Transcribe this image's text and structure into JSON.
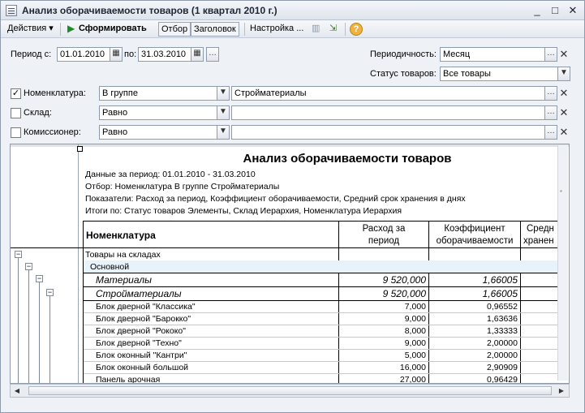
{
  "window": {
    "title": "Анализ оборачиваемости товаров (1 квартал 2010 г.)",
    "controls": [
      "_",
      "□",
      "✕"
    ]
  },
  "toolbar": {
    "actions": "Действия ▾",
    "generate": "Сформировать",
    "filter": "Отбор",
    "header": "Заголовок",
    "settings": "Настройка ..."
  },
  "params": {
    "period_from_label": "Период с:",
    "period_from": "01.01.2010",
    "period_to_label": "по:",
    "period_to": "31.03.2010",
    "periodicity_label": "Периодичность:",
    "periodicity": "Месяц",
    "goods_status_label": "Статус товаров:",
    "goods_status": "Все товары",
    "nomenclature_label": "Номенклатура:",
    "nomenclature_checked": true,
    "nomenclature_cond": "В группе",
    "nomenclature_value": "Стройматериалы",
    "warehouse_label": "Склад:",
    "warehouse_checked": false,
    "warehouse_cond": "Равно",
    "warehouse_value": "",
    "consignor_label": "Комиссионер:",
    "consignor_checked": false,
    "consignor_cond": "Равно",
    "consignor_value": ""
  },
  "report": {
    "title": "Анализ оборачиваемости товаров",
    "line1": "Данные за период: 01.01.2010 - 31.03.2010",
    "line2": "Отбор: Номенклатура В группе Стройматериалы",
    "line3": "Показатели:  Расход за период, Коэффициент оборачиваемости, Средний срок хранения в днях",
    "line4": "Итоги по:  Статус товаров Элементы, Склад Иерархия, Номенклатура Иерархия",
    "col_name": "Номенклатура",
    "col_exp_1": "Расход за",
    "col_exp_2": "период",
    "col_coef_1": "Коэффициент",
    "col_coef_2": "оборачиваемости",
    "col_avg_1": "Средн",
    "col_avg_2": "хранен",
    "rows": [
      {
        "name": "Товары на складах",
        "exp": "",
        "coef": ""
      },
      {
        "name": "Основной",
        "exp": "",
        "coef": ""
      },
      {
        "name": "Материалы",
        "exp": "9 520,000",
        "coef": "1,66005"
      },
      {
        "name": "Стройматериалы",
        "exp": "9 520,000",
        "coef": "1,66005"
      },
      {
        "name": "Блок дверной \"Классика\"",
        "exp": "7,000",
        "coef": "0,96552"
      },
      {
        "name": "Блок дверной \"Барокко\"",
        "exp": "9,000",
        "coef": "1,63636"
      },
      {
        "name": "Блок дверной \"Рококо\"",
        "exp": "8,000",
        "coef": "1,33333"
      },
      {
        "name": "Блок дверной \"Техно\"",
        "exp": "9,000",
        "coef": "2,00000"
      },
      {
        "name": "Блок оконный \"Кантри\"",
        "exp": "5,000",
        "coef": "2,00000"
      },
      {
        "name": "Блок оконный большой",
        "exp": "16,000",
        "coef": "2,90909"
      },
      {
        "name": "Панель арочная",
        "exp": "27,000",
        "coef": "0,96429"
      }
    ]
  }
}
